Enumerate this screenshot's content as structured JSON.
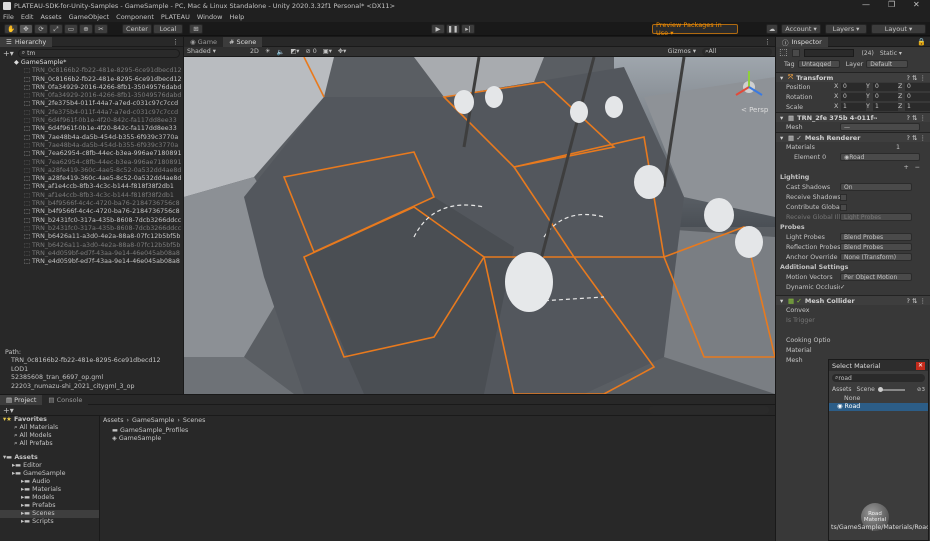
{
  "window": {
    "title": "PLATEAU-SDK-for-Unity-Samples - GameSample - PC, Mac & Linux Standalone - Unity 2020.3.32f1 Personal* <DX11>",
    "controls": [
      "—",
      "❐",
      "✕"
    ]
  },
  "menu": [
    "File",
    "Edit",
    "Assets",
    "GameObject",
    "Component",
    "PLATEAU",
    "Window",
    "Help"
  ],
  "toolbar": {
    "pivot": "Center",
    "space": "Local",
    "preview_packages": "Preview Packages in Use ▾",
    "account": "Account ▾",
    "layers": "Layers ▾",
    "layout": "Layout ▾"
  },
  "hierarchy": {
    "tab": "Hierarchy",
    "search": "tm",
    "root": "GameSample*",
    "items": [
      {
        "label": "TRN_0c8166b2-fb22-481e-8295-6ce91dbecd12",
        "dim": true
      },
      {
        "label": "TRN_0c8166b2-fb22-481e-8295-6ce91dbecd12",
        "dim": false
      },
      {
        "label": "TRN_0fa34929-2016-4266-8fb1-35049576dabd",
        "dim": false
      },
      {
        "label": "TRN_0fa34929-2016-4266-8fb1-35049576dabd",
        "dim": true
      },
      {
        "label": "TRN_2fe375b4-011f-44a7-a7ed-c031c97c7ccd",
        "dim": false
      },
      {
        "label": "TRN_2fe375b4-011f-44a7-a7ed-c031c97c7ccd",
        "dim": true
      },
      {
        "label": "TRN_6d4f961f-0b1e-4f20-842c-fa117dd8ee33",
        "dim": true
      },
      {
        "label": "TRN_6d4f961f-0b1e-4f20-842c-fa117dd8ee33",
        "dim": false
      },
      {
        "label": "TRN_7ae48b4a-da5b-454d-b355-6f939c3770a",
        "dim": false
      },
      {
        "label": "TRN_7ae48b4a-da5b-454d-b355-6f939c3770a",
        "dim": true
      },
      {
        "label": "TRN_7ea62954-c8fb-44ec-b3ea-996ae7180891",
        "dim": false
      },
      {
        "label": "TRN_7ea62954-c8fb-44ec-b3ea-996ae7180891",
        "dim": true
      },
      {
        "label": "TRN_a28fe419-360c-4ae5-8c52-0a532dd4ae8d",
        "dim": true
      },
      {
        "label": "TRN_a28fe419-360c-4ae5-8c52-0a532dd4ae8d",
        "dim": false
      },
      {
        "label": "TRN_af1e4ccb-8fb3-4c3c-b144-f818f38f2db1",
        "dim": false
      },
      {
        "label": "TRN_af1e4ccb-8fb3-4c3c-b144-f818f38f2db1",
        "dim": true
      },
      {
        "label": "TRN_b4f9566f-4c4c-4720-ba76-2184736756c8",
        "dim": true
      },
      {
        "label": "TRN_b4f9566f-4c4c-4720-ba76-2184736756c8",
        "dim": false
      },
      {
        "label": "TRN_b2431fc0-317a-435b-8608-7dcb3266ddcc",
        "dim": false
      },
      {
        "label": "TRN_b2431fc0-317a-435b-8608-7dcb3266ddcc",
        "dim": true
      },
      {
        "label": "TRN_b6426a11-a3d0-4e2a-88a8-07fc12b5bf5b",
        "dim": false
      },
      {
        "label": "TRN_b6426a11-a3d0-4e2a-88a8-07fc12b5bf5b",
        "dim": true
      },
      {
        "label": "TRN_e4d059bf-ed7f-43aa-9e14-46e045ab08a8",
        "dim": true
      },
      {
        "label": "TRN_e4d059bf-ed7f-43aa-9e14-46e045ab08a8",
        "dim": false
      }
    ],
    "path_label": "Path:",
    "path": [
      "TRN_0c8166b2-fb22-481e-8295-6ce91dbecd12",
      "LOD1",
      "52385608_tran_6697_op.gml",
      "22203_numazu-shi_2021_citygml_3_op"
    ]
  },
  "scene": {
    "tabs": [
      "Game",
      "Scene"
    ],
    "shading": "Shaded",
    "mode_2d": "2D",
    "gizmos": "Gizmos ▾",
    "search": "All",
    "persp": "< Persp"
  },
  "inspector": {
    "tab": "Inspector",
    "object_name": "",
    "layer_count": "(24)",
    "static_label": "Static ▾",
    "tag_label": "Tag",
    "tag_value": "Untagged",
    "layer_label": "Layer",
    "layer_value": "Default",
    "transform": {
      "title": "Transform",
      "rows": [
        {
          "label": "Position",
          "x": "0",
          "y": "0",
          "z": "0"
        },
        {
          "label": "Rotation",
          "x": "0",
          "y": "0",
          "z": "0"
        },
        {
          "label": "Scale",
          "x": "1",
          "y": "1",
          "z": "1"
        }
      ]
    },
    "mesh_filter": {
      "title": "TRN_2fe 375b 4-011f-44a 7-",
      "mesh_label": "Mesh",
      "mesh_value": "—"
    },
    "mesh_renderer": {
      "title": "Mesh Renderer",
      "materials_label": "Materials",
      "materials_count": "1",
      "element_label": "Element 0",
      "element_value": "Road",
      "lighting_label": "Lighting",
      "lighting_rows": [
        {
          "label": "Cast Shadows",
          "value": "On",
          "dim": false
        },
        {
          "label": "Receive Shadows",
          "value": "",
          "dim": false
        },
        {
          "label": "Contribute Global I",
          "value": "",
          "dim": false
        },
        {
          "label": "Receive Global Illu",
          "value": "Light Probes",
          "dim": true
        }
      ],
      "probes_label": "Probes",
      "probe_rows": [
        {
          "label": "Light Probes",
          "value": "Blend Probes"
        },
        {
          "label": "Reflection Probes",
          "value": "Blend Probes"
        },
        {
          "label": "Anchor Override",
          "value": "None (Transform)"
        }
      ],
      "additional_label": "Additional Settings",
      "motion_label": "Motion Vectors",
      "motion_value": "Per Object Motion",
      "dynamic_label": "Dynamic Occlusio",
      "dynamic_value": "✓"
    },
    "mesh_collider": {
      "title": "Mesh Collider",
      "rows": [
        "Convex",
        "Is Trigger",
        "",
        "Cooking Optio",
        "Material",
        "Mesh"
      ]
    }
  },
  "project": {
    "tabs": [
      "Project",
      "Console"
    ],
    "favorites": "Favorites",
    "favorite_items": [
      "All Materials",
      "All Models",
      "All Prefabs"
    ],
    "assets_label": "Assets",
    "tree": [
      {
        "label": "Editor",
        "indent": 1
      },
      {
        "label": "GameSample",
        "indent": 1
      },
      {
        "label": "Audio",
        "indent": 2
      },
      {
        "label": "Materials",
        "indent": 2
      },
      {
        "label": "Models",
        "indent": 2
      },
      {
        "label": "Prefabs",
        "indent": 2
      },
      {
        "label": "Scenes",
        "indent": 2
      },
      {
        "label": "Scripts",
        "indent": 2
      }
    ],
    "breadcrumb": [
      "Assets",
      "GameSample",
      "Scenes"
    ],
    "files": [
      "GameSample_Profiles",
      "GameSample"
    ]
  },
  "popup": {
    "title": "Select Material",
    "search": "road",
    "assets_tab": "Assets",
    "scene_tab": "Scene",
    "count": "3",
    "items": [
      "None",
      "Road"
    ],
    "preview_label": "Road\nMaterial",
    "path": "ts/GameSample/Materials/Road"
  },
  "colors": {
    "accent": "#3a72b0",
    "selection": "#2c5d87",
    "preview_orange": "#f48f00",
    "road_edge": "#e87a1e"
  }
}
